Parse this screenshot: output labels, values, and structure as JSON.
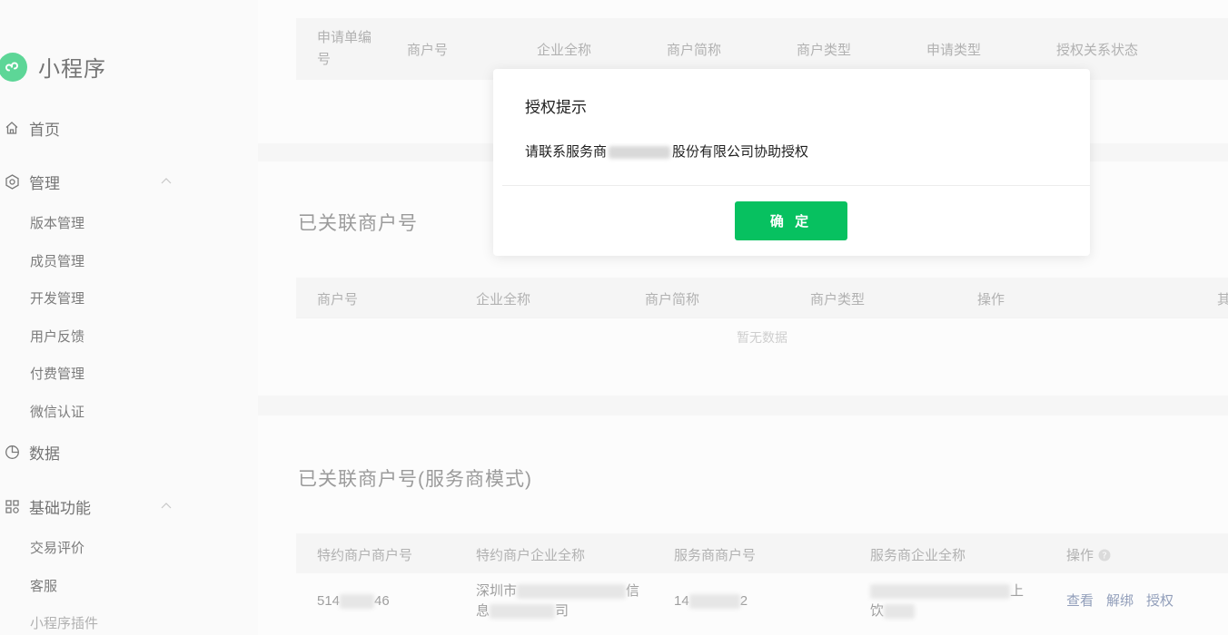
{
  "app": {
    "title": "小程序"
  },
  "sidebar": {
    "home": "首页",
    "manage": {
      "label": "管理",
      "items": [
        "版本管理",
        "成员管理",
        "开发管理",
        "用户反馈",
        "付费管理",
        "微信认证"
      ]
    },
    "data": "数据",
    "basic": {
      "label": "基础功能",
      "items": [
        "交易评价",
        "客服",
        "小程序插件"
      ]
    }
  },
  "apply_table": {
    "headers": [
      "申请单编号",
      "商户号",
      "企业全称",
      "商户简称",
      "商户类型",
      "申请类型",
      "授权关系状态"
    ]
  },
  "linked_section": {
    "title": "已关联商户号",
    "headers": [
      "商户号",
      "企业全称",
      "商户简称",
      "商户类型",
      "操作",
      "其"
    ],
    "empty": "暂无数据"
  },
  "sp_section": {
    "title": "已关联商户号(服务商模式)",
    "headers": [
      "特约商户商户号",
      "特约商户企业全称",
      "服务商商户号",
      "服务商企业全称",
      "操作"
    ],
    "row": {
      "merchant_id_start": "514",
      "merchant_id_end": "46",
      "company_line1_start": "深圳市",
      "company_line1_end": "信",
      "company_line2_start": "息",
      "company_line2_end": "司",
      "sp_id_start": "14",
      "sp_id_end": "2",
      "sp_company_end": "上",
      "sp_company_line2_start": "饮",
      "actions": [
        "查看",
        "解绑",
        "授权"
      ]
    }
  },
  "dialog": {
    "title": "授权提示",
    "message_start": "请联系服务商",
    "message_end": "股份有限公司协助授权",
    "confirm": "确 定"
  },
  "colors": {
    "accent": "#07c160",
    "link": "#576b95"
  }
}
